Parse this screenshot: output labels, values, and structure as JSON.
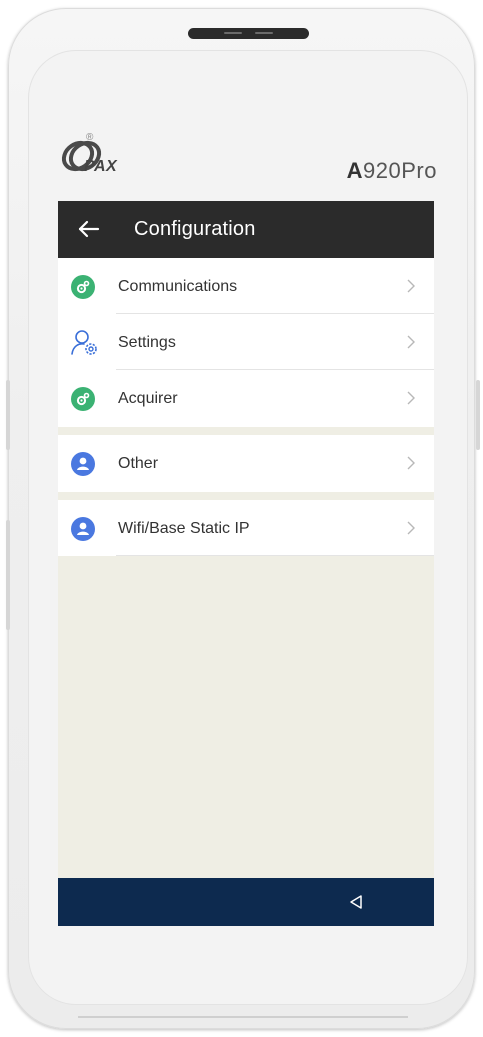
{
  "device": {
    "brand": "PAX",
    "brand_mark": "®",
    "model_prefix": "A",
    "model_suffix": "920Pro"
  },
  "appbar": {
    "title": "Configuration",
    "back_icon": "arrow-left-icon"
  },
  "menu": {
    "groups": [
      {
        "items": [
          {
            "label": "Communications",
            "icon": "gear-badge-green-icon",
            "icon_color": "#3bb273"
          },
          {
            "label": "Settings",
            "icon": "user-gear-outline-icon",
            "icon_color": "#3a6fd8"
          },
          {
            "label": "Acquirer",
            "icon": "gear-badge-green-icon",
            "icon_color": "#3bb273"
          }
        ]
      },
      {
        "items": [
          {
            "label": "Other",
            "icon": "user-badge-blue-icon",
            "icon_color": "#4a78e0"
          }
        ]
      },
      {
        "items": [
          {
            "label": "Wifi/Base Static IP",
            "icon": "user-badge-blue-icon",
            "icon_color": "#4a78e0"
          }
        ]
      }
    ]
  },
  "colors": {
    "appbar_bg": "#2b2b2b",
    "screen_bg": "#efeee4",
    "navbar_bg": "#0d2a4f",
    "divider": "#e4e4e4"
  },
  "navbar": {
    "back_icon": "triangle-back-icon"
  }
}
